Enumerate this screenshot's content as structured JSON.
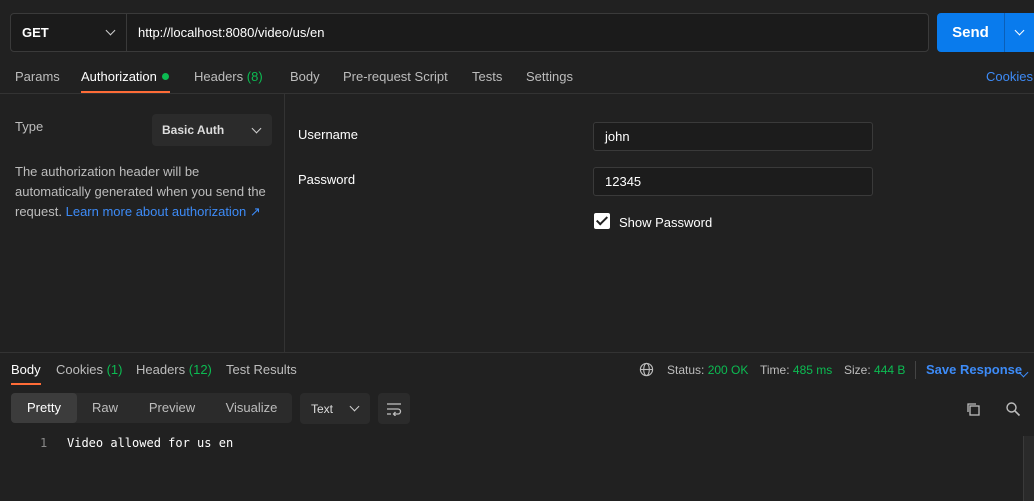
{
  "request": {
    "method": "GET",
    "url": "http://localhost:8080/video/us/en",
    "send_label": "Send"
  },
  "request_tabs": {
    "params": "Params",
    "authorization": "Authorization",
    "headers": "Headers",
    "headers_count": "(8)",
    "body": "Body",
    "pre_request": "Pre-request Script",
    "tests": "Tests",
    "settings": "Settings",
    "cookies": "Cookies"
  },
  "auth": {
    "type_label": "Type",
    "type_value": "Basic Auth",
    "help_text": "The authorization header will be automatically generated when you send the request.",
    "help_link": "Learn more about authorization ↗",
    "username_label": "Username",
    "username_value": "john",
    "password_label": "Password",
    "password_value": "12345",
    "show_password_label": "Show Password",
    "show_password_checked": true
  },
  "response_tabs": {
    "body": "Body",
    "cookies": "Cookies",
    "cookies_count": "(1)",
    "headers": "Headers",
    "headers_count": "(12)",
    "test_results": "Test Results"
  },
  "response_status": {
    "status_label": "Status:",
    "status_value": "200 OK",
    "time_label": "Time:",
    "time_value": "485 ms",
    "size_label": "Size:",
    "size_value": "444 B",
    "save_response": "Save Response"
  },
  "view_modes": {
    "pretty": "Pretty",
    "raw": "Raw",
    "preview": "Preview",
    "visualize": "Visualize",
    "format": "Text"
  },
  "response_body": {
    "lines": [
      {
        "number": "1",
        "text": "Video allowed for us en"
      }
    ]
  },
  "colors": {
    "accent_orange": "#ff6c37",
    "send_blue": "#097bed",
    "link_blue": "#3d8bf7",
    "success_green": "#0cbb52"
  }
}
